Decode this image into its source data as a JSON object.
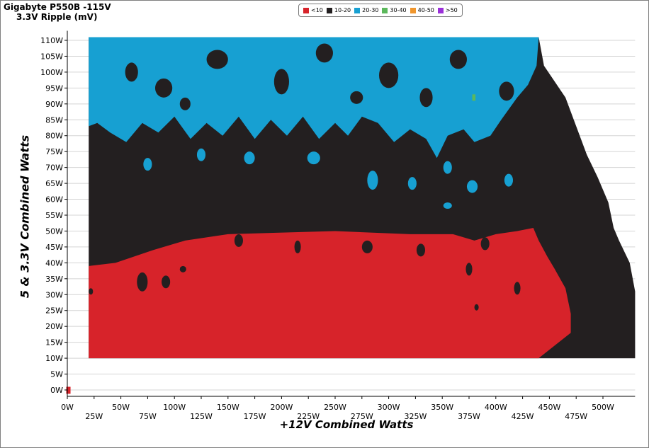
{
  "chart_data": {
    "type": "heatmap",
    "title": "Gigabyte P550B -115V",
    "subtitle": "3.3V Ripple (mV)",
    "xlabel": "+12V Combined Watts",
    "ylabel": "5 & 3.3V Combined Watts",
    "xlim": [
      0,
      530
    ],
    "ylim": [
      -2,
      113
    ],
    "x_ticks": [
      "0W",
      "25W",
      "50W",
      "75W",
      "100W",
      "125W",
      "150W",
      "175W",
      "200W",
      "225W",
      "250W",
      "275W",
      "300W",
      "325W",
      "350W",
      "375W",
      "400W",
      "425W",
      "450W",
      "475W",
      "500W"
    ],
    "y_ticks": [
      "0W",
      "5W",
      "10W",
      "15W",
      "20W",
      "25W",
      "30W",
      "35W",
      "40W",
      "45W",
      "50W",
      "55W",
      "60W",
      "65W",
      "70W",
      "75W",
      "80W",
      "85W",
      "90W",
      "95W",
      "100W",
      "105W",
      "110W"
    ],
    "grid": true,
    "legend_position": "top",
    "legend": [
      {
        "label": "<10",
        "color": "#d7232a"
      },
      {
        "label": "10-20",
        "color": "#231f20"
      },
      {
        "label": "20-30",
        "color": "#17a0d2"
      },
      {
        "label": "30-40",
        "color": "#5cb85c"
      },
      {
        "label": "40-50",
        "color": "#f0962d"
      },
      {
        "label": ">50",
        "color": "#9b30d9"
      }
    ],
    "regions": [
      {
        "category": "<10",
        "approx_extent": "low 5V/3.3V load (about 10W to 50W) across the +12V range up to about 440W; single point at 0W/0W"
      },
      {
        "category": "10-20",
        "approx_extent": "middle band (about 40W to 80W) and the upper-right area, stepping down as +12V load rises toward about 520W"
      },
      {
        "category": "20-30",
        "approx_extent": "high 5V/3.3V load (about 75W to 111W) for +12V load between about 20W and 460W, with scattered islands"
      },
      {
        "category": "30-40",
        "approx_extent": "single cell near 380W +12V, 92W 5V/3.3V"
      }
    ],
    "envelope": [
      [
        20,
        111
      ],
      [
        440,
        111
      ],
      [
        445,
        102
      ],
      [
        455,
        97
      ],
      [
        465,
        92
      ],
      [
        475,
        83
      ],
      [
        485,
        74
      ],
      [
        495,
        67
      ],
      [
        505,
        59
      ],
      [
        510,
        51
      ],
      [
        515,
        47
      ],
      [
        525,
        40
      ],
      [
        530,
        31
      ],
      [
        530,
        10
      ],
      [
        20,
        10
      ]
    ]
  }
}
